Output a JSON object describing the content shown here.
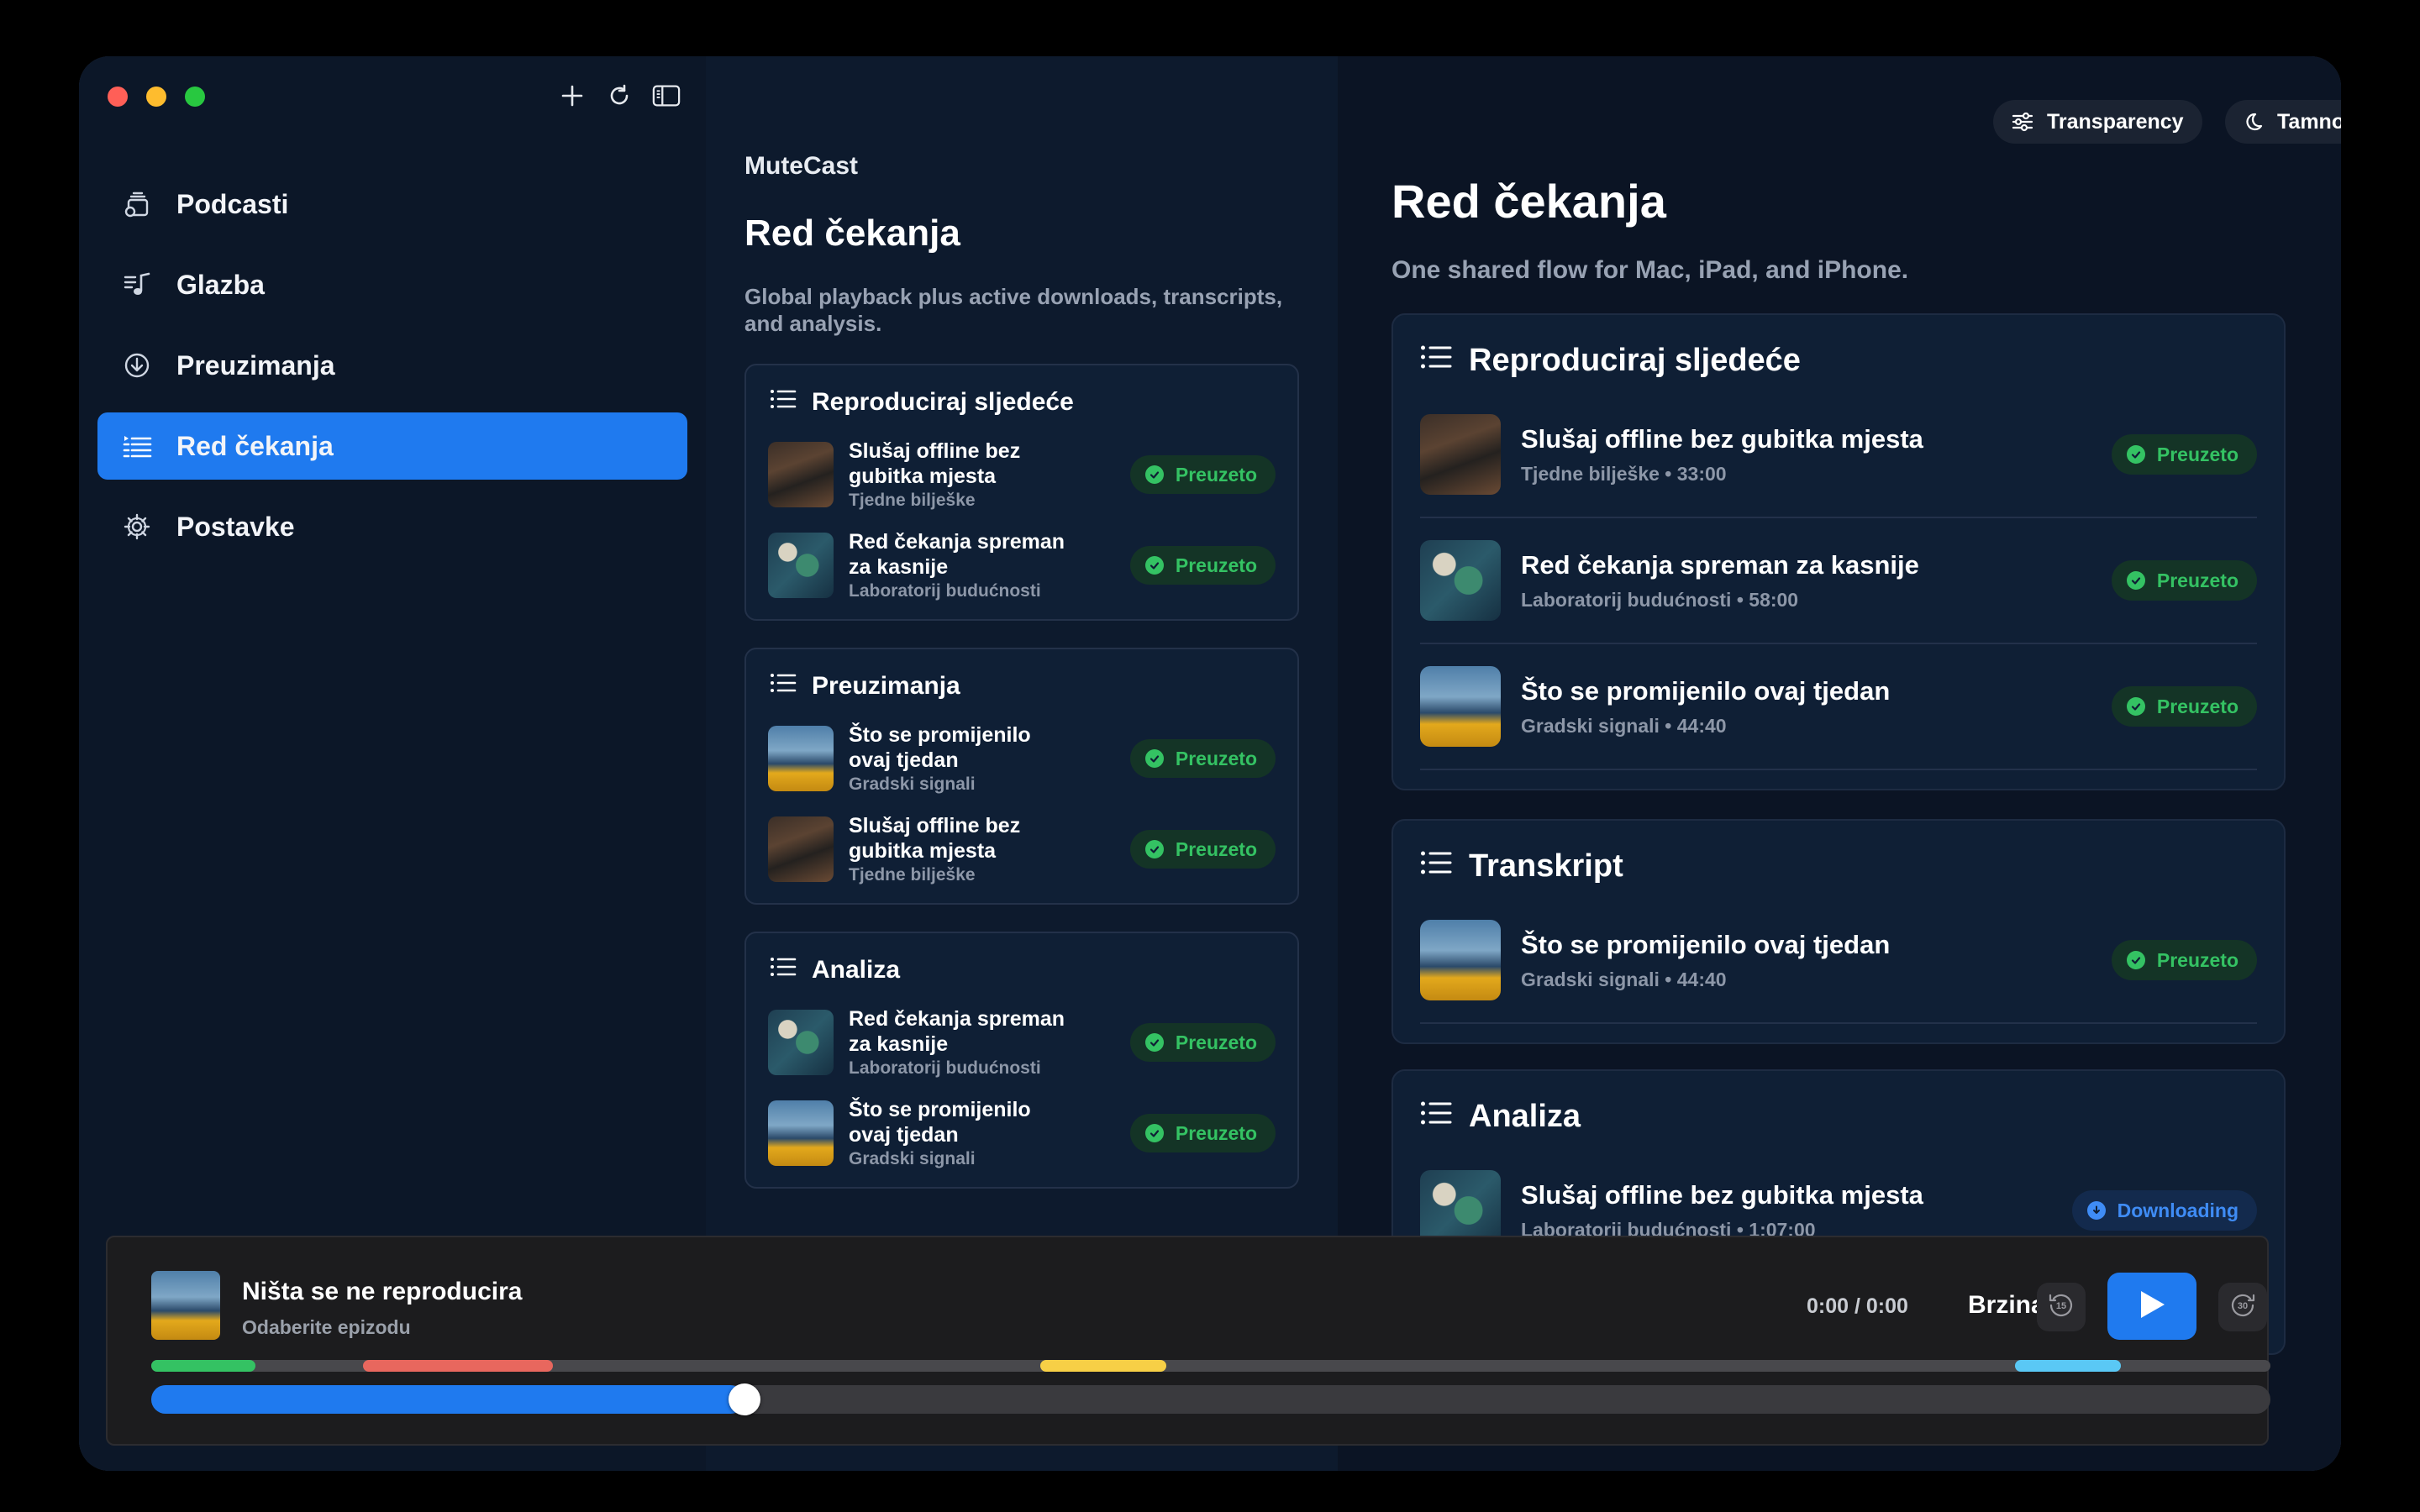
{
  "sidebar": {
    "items": [
      {
        "label": "Podcasti",
        "icon": "podcast-icon"
      },
      {
        "label": "Glazba",
        "icon": "music-icon"
      },
      {
        "label": "Preuzimanja",
        "icon": "download-icon"
      },
      {
        "label": "Red čekanja",
        "icon": "queue-icon",
        "active": true
      },
      {
        "label": "Postavke",
        "icon": "gear-icon"
      }
    ]
  },
  "middle": {
    "brand": "MuteCast",
    "title": "Red čekanja",
    "subtitle": "Global playback plus active downloads, transcripts, and analysis.",
    "sections": [
      {
        "heading": "Reproduciraj sljedeće",
        "rows": [
          {
            "title": "Slušaj offline bez gubitka mjesta",
            "subtitle": "Tjedne bilješke",
            "status": "Preuzeto"
          },
          {
            "title": "Red čekanja spreman za kasnije",
            "subtitle": "Laboratorij budućnosti",
            "status": "Preuzeto"
          }
        ]
      },
      {
        "heading": "Preuzimanja",
        "rows": [
          {
            "title": "Što se promijenilo ovaj tjedan",
            "subtitle": "Gradski signali",
            "status": "Preuzeto"
          },
          {
            "title": "Slušaj offline bez gubitka mjesta",
            "subtitle": "Tjedne bilješke",
            "status": "Preuzeto"
          }
        ]
      },
      {
        "heading": "Analiza",
        "rows": [
          {
            "title": "Red čekanja spreman za kasnije",
            "subtitle": "Laboratorij budućnosti",
            "status": "Preuzeto"
          },
          {
            "title": "Što se promijenilo ovaj tjedan",
            "subtitle": "Gradski signali",
            "status": "Preuzeto"
          }
        ]
      }
    ]
  },
  "right": {
    "transparency_label": "Transparency",
    "theme_label": "Tamno",
    "title": "Red čekanja",
    "subtitle": "One shared flow for Mac, iPad, and iPhone.",
    "sections": [
      {
        "heading": "Reproduciraj sljedeće",
        "rows": [
          {
            "title": "Slušaj offline bez gubitka mjesta",
            "subtitle": "Tjedne bilješke • 33:00",
            "status": "Preuzeto"
          },
          {
            "title": "Red čekanja spreman za kasnije",
            "subtitle": "Laboratorij budućnosti • 58:00",
            "status": "Preuzeto"
          },
          {
            "title": "Što se promijenilo ovaj tjedan",
            "subtitle": "Gradski signali • 44:40",
            "status": "Preuzeto"
          }
        ]
      },
      {
        "heading": "Transkript",
        "rows": [
          {
            "title": "Što se promijenilo ovaj tjedan",
            "subtitle": "Gradski signali • 44:40",
            "status": "Preuzeto"
          }
        ]
      },
      {
        "heading": "Analiza",
        "rows": [
          {
            "title": "Slušaj offline bez gubitka mjesta",
            "subtitle": "Laboratorij budućnosti • 1:07:00",
            "status": "Downloading"
          }
        ]
      }
    ]
  },
  "player": {
    "title": "Ništa se ne reproducira",
    "subtitle": "Odaberite epizodu",
    "time": "0:00 / 0:00",
    "speed_label": "Brzina",
    "skip_back": "15",
    "skip_forward": "30",
    "progress_fraction": 0.28
  },
  "colors": {
    "accent": "#1f7aef",
    "success": "#34c263",
    "chapter_green": "#34c263",
    "chapter_red": "#e8675e",
    "chapter_yellow": "#f7cf46",
    "chapter_cyan": "#5ac8f5"
  }
}
